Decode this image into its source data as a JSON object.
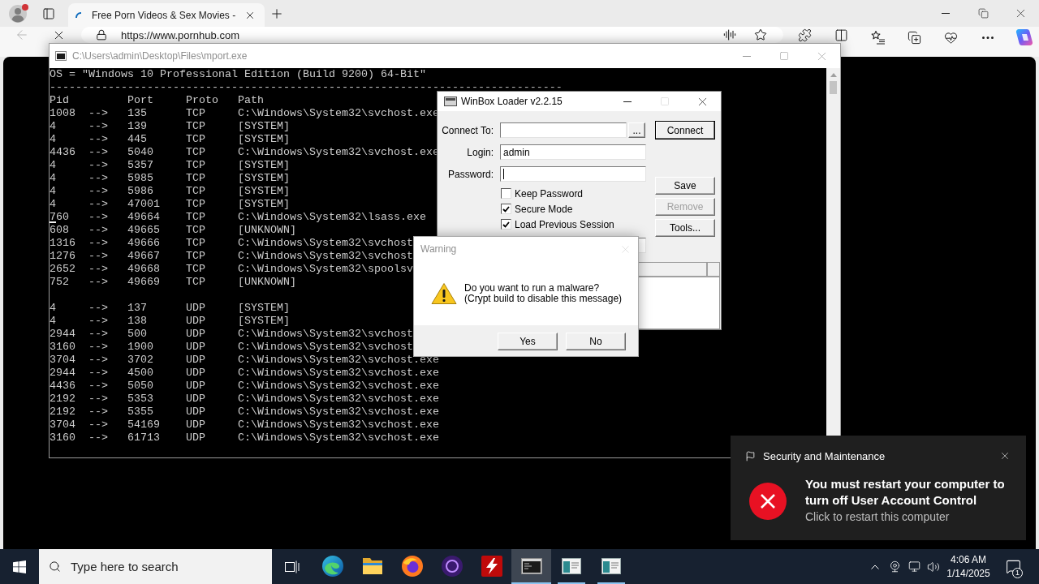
{
  "browser": {
    "tabs": [
      {
        "title": "Free Porn Videos & Sex Movies -",
        "selected": true,
        "loading": true
      }
    ],
    "back_disabled": true,
    "address": "https://www.pornhub.com"
  },
  "console_window": {
    "title": "C:\\Users\\admin\\Desktop\\Files\\mport.exe",
    "active": false,
    "os_line": "OS = \"Windows 10 Professional Edition (Build 9200) 64-Bit\"",
    "separator": "-------------------------------------------------------------------------------",
    "columns": [
      "Pid",
      "Port",
      "Proto",
      "Path"
    ],
    "groups": [
      {
        "rows": [
          {
            "pid": "1008",
            "arrow": "-->",
            "port": "135",
            "proto": "TCP",
            "path": "C:\\Windows\\System32\\svchost.exe",
            "cursor": false
          },
          {
            "pid": "4",
            "arrow": "-->",
            "port": "139",
            "proto": "TCP",
            "path": "[SYSTEM]",
            "cursor": false
          },
          {
            "pid": "4",
            "arrow": "-->",
            "port": "445",
            "proto": "TCP",
            "path": "[SYSTEM]",
            "cursor": false
          },
          {
            "pid": "4436",
            "arrow": "-->",
            "port": "5040",
            "proto": "TCP",
            "path": "C:\\Windows\\System32\\svchost.exe",
            "cursor": false
          },
          {
            "pid": "4",
            "arrow": "-->",
            "port": "5357",
            "proto": "TCP",
            "path": "[SYSTEM]",
            "cursor": false
          },
          {
            "pid": "4",
            "arrow": "-->",
            "port": "5985",
            "proto": "TCP",
            "path": "[SYSTEM]",
            "cursor": false
          },
          {
            "pid": "4",
            "arrow": "-->",
            "port": "5986",
            "proto": "TCP",
            "path": "[SYSTEM]",
            "cursor": false
          },
          {
            "pid": "4",
            "arrow": "-->",
            "port": "47001",
            "proto": "TCP",
            "path": "[SYSTEM]",
            "cursor": false
          },
          {
            "pid": "760",
            "arrow": "-->",
            "port": "49664",
            "proto": "TCP",
            "path": "C:\\Windows\\System32\\lsass.exe",
            "cursor": true
          },
          {
            "pid": "608",
            "arrow": "-->",
            "port": "49665",
            "proto": "TCP",
            "path": "[UNKNOWN]",
            "cursor": false
          },
          {
            "pid": "1316",
            "arrow": "-->",
            "port": "49666",
            "proto": "TCP",
            "path": "C:\\Windows\\System32\\svchost",
            "cursor": false
          },
          {
            "pid": "1276",
            "arrow": "-->",
            "port": "49667",
            "proto": "TCP",
            "path": "C:\\Windows\\System32\\svchost",
            "cursor": false
          },
          {
            "pid": "2652",
            "arrow": "-->",
            "port": "49668",
            "proto": "TCP",
            "path": "C:\\Windows\\System32\\spoolsv",
            "cursor": false
          },
          {
            "pid": "752",
            "arrow": "-->",
            "port": "49669",
            "proto": "TCP",
            "path": "[UNKNOWN]",
            "cursor": false
          }
        ]
      },
      {
        "rows": [
          {
            "pid": "4",
            "arrow": "-->",
            "port": "137",
            "proto": "UDP",
            "path": "[SYSTEM]",
            "cursor": false
          },
          {
            "pid": "4",
            "arrow": "-->",
            "port": "138",
            "proto": "UDP",
            "path": "[SYSTEM]",
            "cursor": false
          },
          {
            "pid": "2944",
            "arrow": "-->",
            "port": "500",
            "proto": "UDP",
            "path": "C:\\Windows\\System32\\svchost",
            "cursor": false
          },
          {
            "pid": "3160",
            "arrow": "-->",
            "port": "1900",
            "proto": "UDP",
            "path": "C:\\Windows\\System32\\svchost",
            "cursor": false
          },
          {
            "pid": "3704",
            "arrow": "-->",
            "port": "3702",
            "proto": "UDP",
            "path": "C:\\Windows\\System32\\svchost.exe",
            "cursor": false
          },
          {
            "pid": "2944",
            "arrow": "-->",
            "port": "4500",
            "proto": "UDP",
            "path": "C:\\Windows\\System32\\svchost.exe",
            "cursor": false
          },
          {
            "pid": "4436",
            "arrow": "-->",
            "port": "5050",
            "proto": "UDP",
            "path": "C:\\Windows\\System32\\svchost.exe",
            "cursor": false
          },
          {
            "pid": "2192",
            "arrow": "-->",
            "port": "5353",
            "proto": "UDP",
            "path": "C:\\Windows\\System32\\svchost.exe",
            "cursor": false
          },
          {
            "pid": "2192",
            "arrow": "-->",
            "port": "5355",
            "proto": "UDP",
            "path": "C:\\Windows\\System32\\svchost.exe",
            "cursor": false
          },
          {
            "pid": "3704",
            "arrow": "-->",
            "port": "54169",
            "proto": "UDP",
            "path": "C:\\Windows\\System32\\svchost.exe",
            "cursor": false
          },
          {
            "pid": "3160",
            "arrow": "-->",
            "port": "61713",
            "proto": "UDP",
            "path": "C:\\Windows\\System32\\svchost.exe",
            "cursor": false
          }
        ]
      }
    ]
  },
  "winbox_window": {
    "title": "WinBox Loader v2.2.15",
    "active": true,
    "maximize_disabled": true,
    "fields": [
      {
        "label": "Connect To:",
        "browse_button": "...",
        "focused": false
      },
      {
        "label": "Login:",
        "value": "admin",
        "focused": false
      },
      {
        "label": "Password:",
        "focused": true
      }
    ],
    "checkboxes": [
      {
        "label": "Keep Password",
        "checked": false
      },
      {
        "label": "Secure Mode",
        "checked": true
      },
      {
        "label": "Load Previous Session",
        "checked": true
      }
    ],
    "connect_button": {
      "label": "Connect",
      "default": true
    },
    "side_buttons": [
      {
        "label": "Save",
        "disabled": false
      },
      {
        "label": "Remove",
        "disabled": true
      },
      {
        "label": "Tools...",
        "disabled": false
      }
    ]
  },
  "warning_dialog": {
    "title": "Warning",
    "active": false,
    "message": [
      "Do you want to run a malware?",
      "(Crypt build to disable this message)"
    ],
    "buttons": [
      "Yes",
      "No"
    ]
  },
  "toast": {
    "app": "Security and Maintenance",
    "heading": "You must restart your computer to turn off User Account Control",
    "body": "Click to restart this computer"
  },
  "taskbar": {
    "search_placeholder": "Type here to search",
    "apps": [
      {
        "kind": "swirl",
        "running": false,
        "selected": false
      },
      {
        "kind": "folder",
        "running": false,
        "selected": false
      },
      {
        "kind": "fox",
        "running": false,
        "selected": false
      },
      {
        "kind": "orb",
        "running": false,
        "selected": false
      },
      {
        "kind": "ftp",
        "running": false,
        "selected": false
      },
      {
        "kind": "terminal",
        "running": true,
        "selected": true
      },
      {
        "kind": "window",
        "running": true,
        "selected": false
      },
      {
        "kind": "window",
        "running": true,
        "selected": false
      }
    ],
    "clock": {
      "time": "4:06 AM",
      "date": "1/14/2025"
    },
    "notification_count": "1"
  }
}
